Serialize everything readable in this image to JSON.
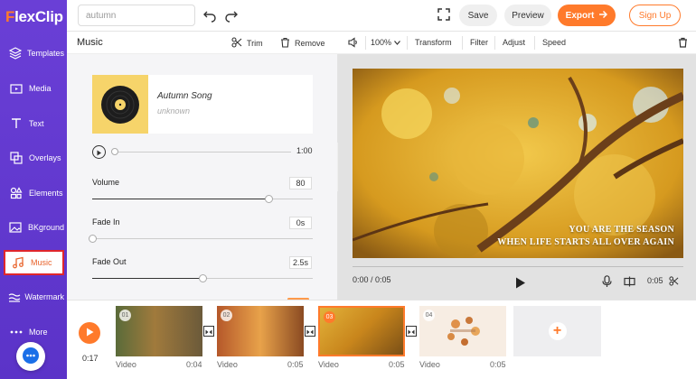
{
  "app": {
    "logo_first": "F",
    "logo_rest": "lexClip"
  },
  "sidebar": {
    "items": [
      {
        "label": "Templates",
        "icon": "layers-icon"
      },
      {
        "label": "Media",
        "icon": "media-folder-icon"
      },
      {
        "label": "Text",
        "icon": "text-icon"
      },
      {
        "label": "Overlays",
        "icon": "overlays-icon"
      },
      {
        "label": "Elements",
        "icon": "elements-icon"
      },
      {
        "label": "BKground",
        "icon": "background-icon"
      },
      {
        "label": "Music",
        "icon": "music-note-icon",
        "active": true
      },
      {
        "label": "Watermark",
        "icon": "watermark-icon"
      },
      {
        "label": "More",
        "icon": "more-dots-icon"
      }
    ]
  },
  "topbar": {
    "search_value": "autumn",
    "save_label": "Save",
    "preview_label": "Preview",
    "export_label": "Export",
    "signup_label": "Sign Up"
  },
  "music_panel": {
    "title": "Music",
    "trim_label": "Trim",
    "remove_label": "Remove",
    "song_title": "Autumn Song",
    "song_artist": "unknown",
    "duration": "1:00",
    "volume_label": "Volume",
    "volume_value": "80",
    "volume_level": 0.8,
    "fade_in_label": "Fade In",
    "fade_in_value": "0s",
    "fade_in_level": 0,
    "fade_out_label": "Fade Out",
    "fade_out_value": "2.5s",
    "fade_out_level": 0.5
  },
  "preview_toolbar": {
    "zoom": "100%",
    "transform_label": "Transform",
    "filter_label": "Filter",
    "adjust_label": "Adjust",
    "speed_label": "Speed"
  },
  "preview": {
    "caption_line1": "YOU ARE THE SEASON",
    "caption_line2": "WHEN LIFE STARTS ALL OVER AGAIN",
    "current_time": "0:00 / 0:05",
    "end_time": "0:05"
  },
  "timeline": {
    "time": "0:17",
    "clips": [
      {
        "num": "01",
        "label": "Video",
        "duration": "0:04",
        "selected": false
      },
      {
        "num": "02",
        "label": "Video",
        "duration": "0:05",
        "selected": false
      },
      {
        "num": "03",
        "label": "Video",
        "duration": "0:05",
        "selected": true
      },
      {
        "num": "04",
        "label": "Video",
        "duration": "0:05",
        "selected": false
      }
    ]
  },
  "colors": {
    "accent": "#ff7a2b",
    "sidebar": "#5b33c8"
  }
}
